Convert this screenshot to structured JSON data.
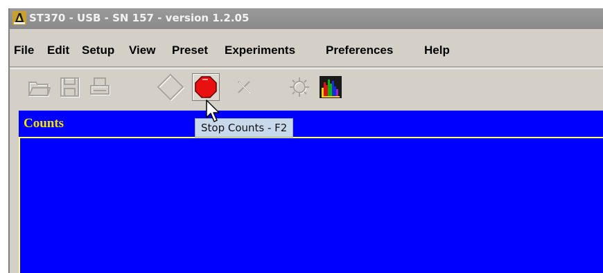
{
  "window": {
    "title": "ST370 - USB - SN 157 - version 1.2.05",
    "icon": "app-logo-icon"
  },
  "menubar": {
    "items": [
      {
        "label": "File"
      },
      {
        "label": "Edit"
      },
      {
        "label": "Setup"
      },
      {
        "label": "View"
      },
      {
        "label": "Preset"
      },
      {
        "label": "Experiments"
      },
      {
        "label": "Preferences"
      },
      {
        "label": "Help"
      }
    ]
  },
  "toolbar": {
    "buttons": [
      {
        "icon": "open-folder-icon",
        "enabled": false
      },
      {
        "icon": "save-disk-icon",
        "enabled": false
      },
      {
        "icon": "print-icon",
        "enabled": false
      },
      {
        "icon": "start-diamond-icon",
        "enabled": false
      },
      {
        "icon": "stop-octagon-icon",
        "enabled": true
      },
      {
        "icon": "clear-x-icon",
        "enabled": false
      },
      {
        "icon": "settings-gear-icon",
        "enabled": false
      },
      {
        "icon": "histogram-icon",
        "enabled": true
      }
    ]
  },
  "tooltip": {
    "text": "Stop Counts - F2"
  },
  "panel": {
    "title": "Counts"
  },
  "colors": {
    "panel_background": "#0000ff",
    "panel_title": "#f5e400",
    "plot_border": "#ffff66",
    "stop_button": "#e81010",
    "tooltip_background": "#c9d9ec"
  }
}
